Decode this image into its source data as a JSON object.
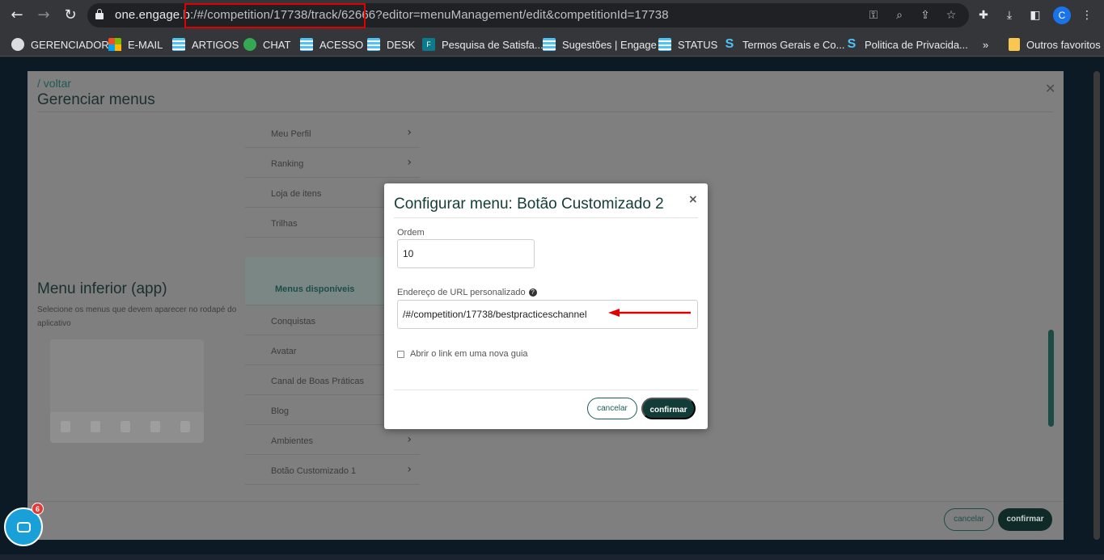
{
  "browser": {
    "url_host": "one.engage.b",
    "url_path": ":/#/competition/17738/track/62666?editor=menuManagement/edit&competitionId=17738",
    "profile_initial": "C",
    "icons": [
      "back-icon",
      "forward-icon",
      "reload-icon",
      "lock-icon",
      "key-icon",
      "zoom-icon",
      "share-icon",
      "star-icon",
      "extensions-icon",
      "download-icon",
      "sidepanel-icon",
      "menu-icon"
    ]
  },
  "bookmarks": [
    {
      "label": "GERENCIADOR",
      "icon": "globe"
    },
    {
      "label": "E-MAIL",
      "icon": "microsoft"
    },
    {
      "label": "ARTIGOS",
      "icon": "stripe"
    },
    {
      "label": "CHAT",
      "icon": "chat"
    },
    {
      "label": "ACESSO",
      "icon": "stripe"
    },
    {
      "label": "DESK",
      "icon": "stripe"
    },
    {
      "label": "Pesquisa de Satisfa...",
      "icon": "forms"
    },
    {
      "label": "Sugestões | Engage",
      "icon": "stripe"
    },
    {
      "label": "STATUS",
      "icon": "stripe"
    },
    {
      "label": "Termos Gerais e Co...",
      "icon": "s-logo"
    },
    {
      "label": "Politica de Privacida...",
      "icon": "s-logo"
    }
  ],
  "bookmarks_more": "»",
  "bookmarks_other": "Outros favoritos",
  "panel": {
    "back": "/ voltar",
    "title": "Gerenciar menus",
    "top_menu_items": [
      "Meu Perfil",
      "Ranking",
      "Loja de itens",
      "Trilhas"
    ],
    "section_title": "Menu inferior (app)",
    "section_desc": "Selecione os menus que devem aparecer no rodapé do aplicativo",
    "available_header": "Menus disponíveis",
    "available_items": [
      "Conquistas",
      "Avatar",
      "Canal de Boas Práticas",
      "Blog",
      "Ambientes",
      "Botão Customizado 1"
    ],
    "cancel": "cancelar",
    "confirm": "confirmar"
  },
  "modal": {
    "title": "Configurar menu: Botão Customizado 2",
    "close": "×",
    "order_label": "Ordem",
    "order_value": "10",
    "url_label": "Endereço de URL personalizado",
    "url_value": "/#/competition/17738/bestpracticeschannel",
    "new_tab_label": "Abrir o link em uma nova guia",
    "new_tab_checked": false,
    "cancel": "cancelar",
    "confirm": "confirmar"
  },
  "chat_widget": {
    "badge": "6"
  },
  "colors": {
    "accent": "#123c38",
    "annotation": "#e00000"
  }
}
